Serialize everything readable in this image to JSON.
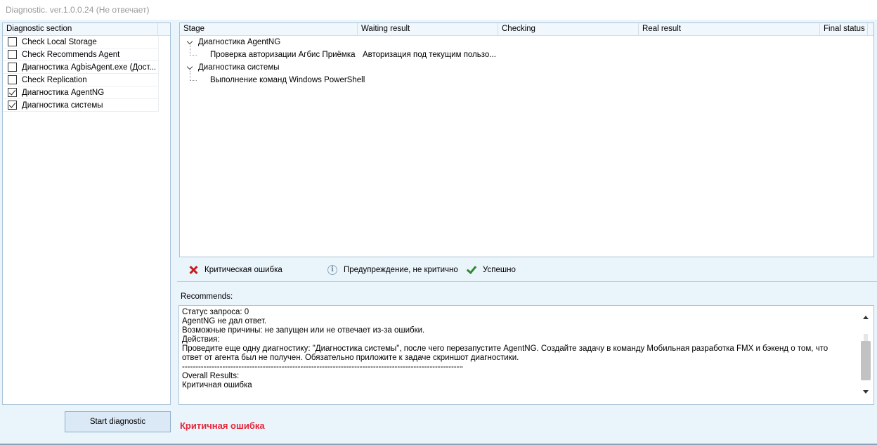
{
  "window": {
    "title": "Diagnostic. ver.1.0.0.24 (Не отвечает)"
  },
  "sections": {
    "header": "Diagnostic section",
    "items": [
      {
        "label": "Check Local Storage",
        "checked": false
      },
      {
        "label": "Check Recommends Agent",
        "checked": false
      },
      {
        "label": "Диагностика AgbisAgent.exe (Дост...",
        "checked": false
      },
      {
        "label": "Check Replication",
        "checked": false
      },
      {
        "label": "Диагностика AgentNG",
        "checked": true
      },
      {
        "label": "Диагностика системы",
        "checked": true
      }
    ]
  },
  "stages": {
    "columns": [
      "Stage",
      "Waiting result",
      "Checking",
      "Real result",
      "Final status"
    ],
    "rows": [
      {
        "stage": "Диагностика AgentNG",
        "waiting": "",
        "level": 0
      },
      {
        "stage": "Проверка авторизации Агбис Приёмка",
        "waiting": "Авторизация под текущим пользо...",
        "level": 1
      },
      {
        "stage": "Диагностика системы",
        "waiting": "",
        "level": 0
      },
      {
        "stage": "Выполнение команд Windows PowerShell",
        "waiting": "",
        "level": 1
      }
    ]
  },
  "legend": {
    "critical": "Критическая ошибка",
    "warning": "Предупреждение, не критично",
    "success": "Успешно"
  },
  "recommends": {
    "label": "Recommends:",
    "lines": [
      "Статус запроса: 0",
      "AgentNG не дал ответ.",
      "Возможные причины: не запущен или не отвечает из-за ошибки.",
      "Действия:",
      "Проведите еще одну диагностику: \"Диагностика системы\", после чего перезапустите AgentNG. Создайте задачу в команду Мобильная разработка FMX и бэкенд о том, что ответ от агента был не получен. Обязательно приложите к задаче скриншот диагностики.",
      "------------------------------------------------------------------------------------------------------------",
      "Overall Results:",
      "Критичная ошибка"
    ]
  },
  "actions": {
    "start_label": "Start diagnostic"
  },
  "status": {
    "text": "Критичная ошибка",
    "color": "#e4263a"
  }
}
